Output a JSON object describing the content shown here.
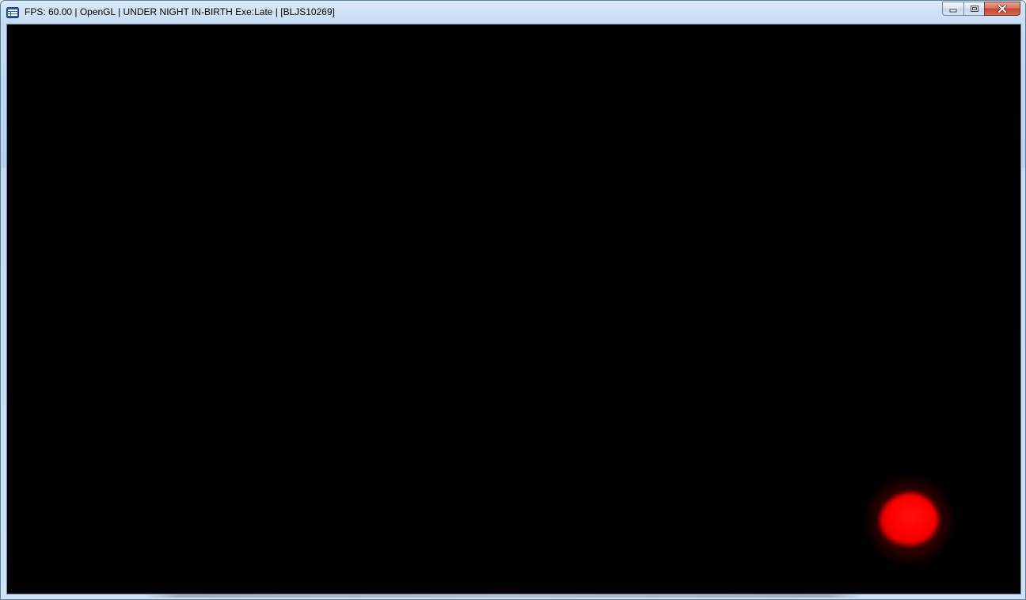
{
  "window": {
    "title": "FPS: 60.00 | OpenGL | UNDER NIGHT IN-BIRTH Exe:Late | [BLJS10269]",
    "app_icon": "rpcs3-window-icon",
    "controls": {
      "minimize_icon": "minimize-icon",
      "maximize_icon": "maximize-icon",
      "close_icon": "close-icon"
    }
  },
  "viewport": {
    "background_color": "#000000",
    "indicator_color": "#ff0000",
    "indicator_icon": "loading-orb-icon"
  }
}
